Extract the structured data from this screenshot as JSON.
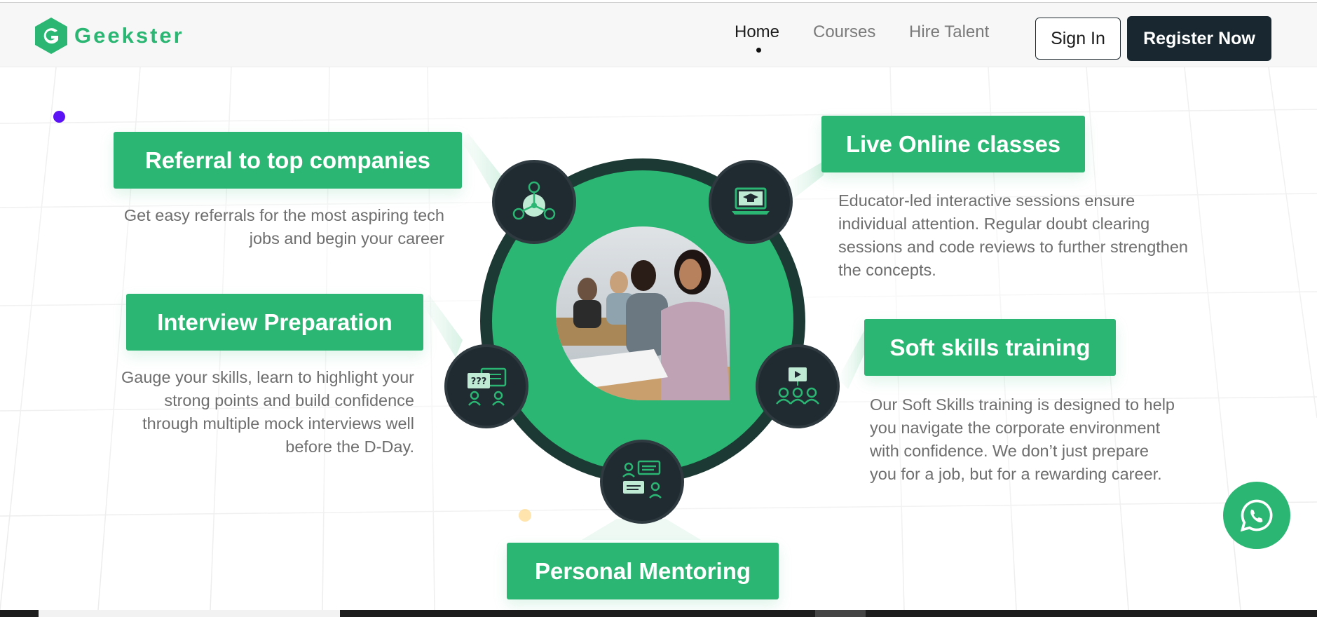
{
  "brand": {
    "name": "Geekster",
    "accent": "#2bb673",
    "dark": "#192830"
  },
  "nav": {
    "items": [
      {
        "label": "Home",
        "active": true
      },
      {
        "label": "Courses",
        "active": false
      },
      {
        "label": "Hire Talent",
        "active": false
      }
    ],
    "sign_in": "Sign In",
    "register": "Register Now"
  },
  "features": {
    "referral": {
      "title": "Referral to top companies",
      "desc_lines": [
        "Get easy referrals for the most aspiring tech",
        "jobs and begin your career"
      ],
      "icon": "network-people-icon"
    },
    "interview": {
      "title": "Interview Preparation",
      "desc_lines": [
        "Gauge your skills, learn to highlight your",
        "strong points and build confidence",
        "through multiple mock interviews well",
        "before the D-Day."
      ],
      "icon": "interview-chat-icon"
    },
    "live": {
      "title": "Live Online classes",
      "desc_lines": [
        "Educator-led interactive sessions ensure",
        "individual attention. Regular doubt clearing",
        "sessions and code reviews to further strengthen",
        "the concepts."
      ],
      "icon": "laptop-graduation-icon"
    },
    "soft": {
      "title": "Soft skills training",
      "desc_lines": [
        "Our Soft Skills training is designed to help",
        "you navigate the corporate environment",
        "with confidence. We don’t just prepare",
        "you for a job, but for a rewarding career."
      ],
      "icon": "presentation-group-icon"
    },
    "mentoring": {
      "title": "Personal Mentoring",
      "icon": "mentoring-chat-icon"
    }
  },
  "center_image": {
    "alt": "students-in-classroom-photo"
  },
  "whatsapp": {
    "icon": "whatsapp-icon"
  }
}
